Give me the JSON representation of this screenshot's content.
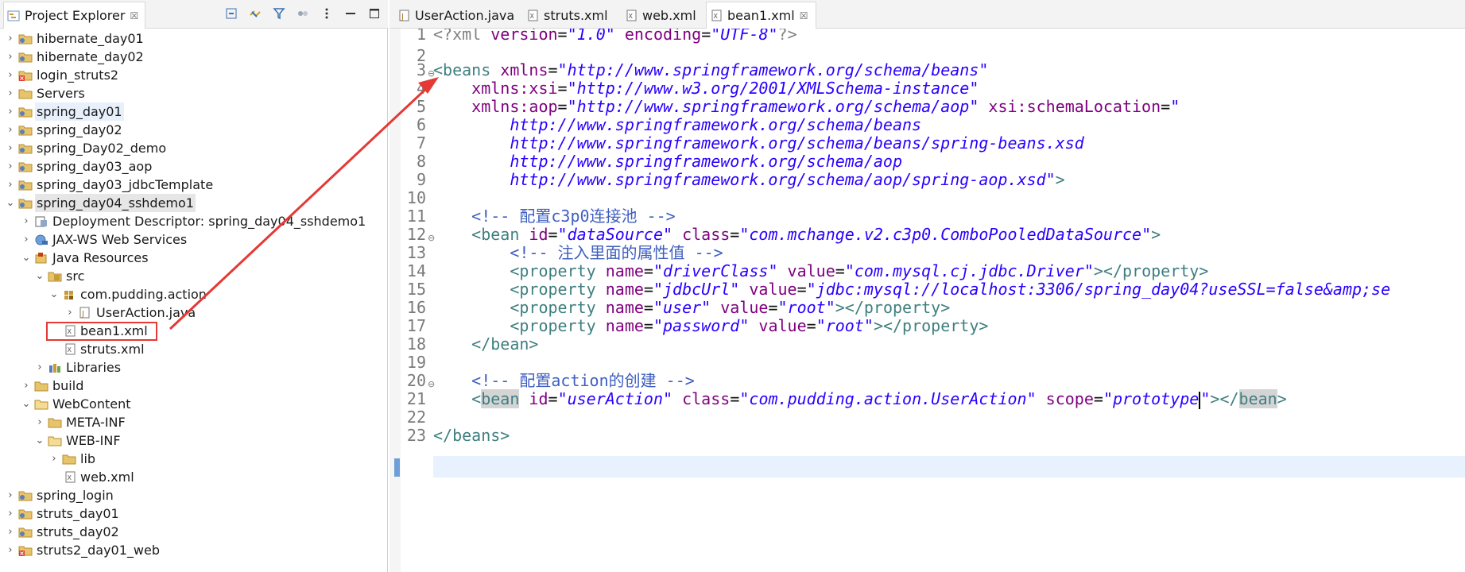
{
  "explorer": {
    "title": "Project Explorer",
    "title_suffix": "☒",
    "items": [
      {
        "label": "hibernate_day01"
      },
      {
        "label": "hibernate_day02"
      },
      {
        "label": "login_struts2"
      },
      {
        "label": "Servers"
      },
      {
        "label": "spring_day01"
      },
      {
        "label": "spring_day02"
      },
      {
        "label": "spring_Day02_demo"
      },
      {
        "label": "spring_day03_aop"
      },
      {
        "label": "spring_day03_jdbcTemplate"
      },
      {
        "label": "spring_day04_sshdemo1"
      },
      {
        "label": "Deployment Descriptor: spring_day04_sshdemo1"
      },
      {
        "label": "JAX-WS Web Services"
      },
      {
        "label": "Java Resources"
      },
      {
        "label": "src"
      },
      {
        "label": "com.pudding.action"
      },
      {
        "label": "UserAction.java"
      },
      {
        "label": "bean1.xml"
      },
      {
        "label": "struts.xml"
      },
      {
        "label": "Libraries"
      },
      {
        "label": "build"
      },
      {
        "label": "WebContent"
      },
      {
        "label": "META-INF"
      },
      {
        "label": "WEB-INF"
      },
      {
        "label": "lib"
      },
      {
        "label": "web.xml"
      },
      {
        "label": "spring_login"
      },
      {
        "label": "struts_day01"
      },
      {
        "label": "struts_day02"
      },
      {
        "label": "struts2_day01_web"
      }
    ]
  },
  "tabs": [
    {
      "label": "UserAction.java"
    },
    {
      "label": "struts.xml"
    },
    {
      "label": "web.xml"
    },
    {
      "label": "bean1.xml",
      "close": "☒"
    }
  ],
  "editor": {
    "line_numbers": [
      "1",
      "2",
      "3",
      "4",
      "5",
      "6",
      "7",
      "8",
      "9",
      "10",
      "11",
      "12",
      "13",
      "14",
      "15",
      "16",
      "17",
      "18",
      "19",
      "20",
      "21",
      "22",
      "23"
    ],
    "l1": {
      "a": "<?xml ",
      "b": "version",
      "c": "=",
      "d": "\"1.0\"",
      "e": " encoding",
      "f": "=",
      "g": "\"UTF-8\"",
      "h": "?>"
    },
    "l3": {
      "a": "<beans",
      "b": " xmlns",
      "c": "=",
      "d": "\"http://www.springframework.org/schema/beans\""
    },
    "l4": {
      "a": "    xmlns:xsi",
      "b": "=",
      "c": "\"http://www.w3.org/2001/XMLSchema-instance\""
    },
    "l5": {
      "a": "    xmlns:aop",
      "b": "=",
      "c": "\"http://www.springframework.org/schema/aop\"",
      "d": " xsi:schemaLocation",
      "e": "=",
      "f": "\""
    },
    "l6": "        http://www.springframework.org/schema/beans",
    "l7": "        http://www.springframework.org/schema/beans/spring-beans.xsd",
    "l8": "        http://www.springframework.org/schema/aop",
    "l9": {
      "a": "        http://www.springframework.org/schema/aop/spring-aop.xsd\"",
      "b": ">"
    },
    "l11": "    <!-- 配置c3p0连接池 -->",
    "l12": {
      "a": "    <bean",
      "b": " id",
      "c": "=",
      "d": "\"dataSource\"",
      "e": " class",
      "f": "=",
      "g": "\"com.mchange.v2.c3p0.ComboPooledDataSource\"",
      "h": ">"
    },
    "l13": "        <!-- 注入里面的属性值 -->",
    "l14": {
      "a": "        <property",
      "b": " name",
      "c": "=",
      "d": "\"driverClass\"",
      "e": " value",
      "f": "=",
      "g": "\"com.mysql.cj.jdbc.Driver\"",
      "h": "></property>"
    },
    "l15": {
      "a": "        <property",
      "b": " name",
      "c": "=",
      "d": "\"jdbcUrl\"",
      "e": " value",
      "f": "=",
      "g": "\"jdbc:mysql://localhost:3306/spring_day04?useSSL=false&amp;se"
    },
    "l16": {
      "a": "        <property",
      "b": " name",
      "c": "=",
      "d": "\"user\"",
      "e": " value",
      "f": "=",
      "g": "\"root\"",
      "h": "></property>"
    },
    "l17": {
      "a": "        <property",
      "b": " name",
      "c": "=",
      "d": "\"password\"",
      "e": " value",
      "f": "=",
      "g": "\"root\"",
      "h": "></property>"
    },
    "l18": "    </bean>",
    "l20": "    <!-- 配置action的创建 -->",
    "l21": {
      "a": "    <",
      "b": "bean",
      "c": " id",
      "d": "=",
      "e": "\"userAction\"",
      "f": " class",
      "g": "=",
      "h": "\"com.pudding.action.UserAction\"",
      "i": " scope",
      "j": "=",
      "k": "\"prototype",
      "l": "\"",
      "m": "></",
      "n": "bean",
      "o": ">"
    },
    "l23": "</beans>"
  },
  "colors": {
    "tag": "#3f7f7f",
    "attribute": "#7f007f",
    "value": "#2a00ff",
    "comment": "#3f5fbf",
    "annotation": "#e53935",
    "current_line": "#e8f2fe"
  },
  "icons": [
    "project-icon",
    "error-project-icon",
    "folder-icon",
    "package-icon",
    "java-file-icon",
    "xml-file-icon",
    "library-icon",
    "collapse-all-icon",
    "link-editor-icon",
    "filter-icon",
    "view-menu-icon",
    "minimize-icon",
    "maximize-icon",
    "twistie-icon",
    "fold-icon"
  ]
}
